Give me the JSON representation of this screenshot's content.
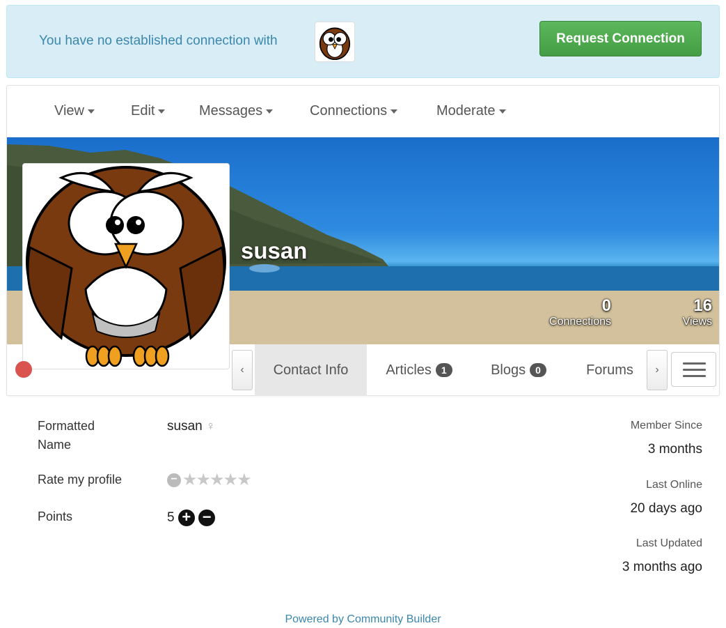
{
  "alert": {
    "text": "You have no established connection with",
    "button_label": "Request Connection"
  },
  "menu": {
    "items": [
      {
        "label": "View"
      },
      {
        "label": "Edit"
      },
      {
        "label": "Messages"
      },
      {
        "label": "Connections"
      },
      {
        "label": "Moderate"
      }
    ]
  },
  "profile": {
    "name": "susan",
    "status_color": "#d9534f",
    "stats": {
      "connections": {
        "value": "0",
        "label": "Connections"
      },
      "views": {
        "value": "16",
        "label": "Views"
      }
    }
  },
  "tabs": {
    "prev_icon": "chevron-left-icon",
    "next_icon": "chevron-right-icon",
    "items": [
      {
        "label": "Contact Info",
        "active": true
      },
      {
        "label": "Articles",
        "badge": "1"
      },
      {
        "label": "Blogs",
        "badge": "0"
      },
      {
        "label": "Forums"
      }
    ]
  },
  "fields": {
    "formatted_name_label": "Formatted Name",
    "formatted_name_value": "susan",
    "gender_icon": "female-icon",
    "rating_label": "Rate my profile",
    "rating_value": 0,
    "rating_max": 5,
    "points_label": "Points",
    "points_value": "5",
    "member_since_label": "Member Since",
    "member_since_value": "3 months",
    "last_online_label": "Last Online",
    "last_online_value": "20 days ago",
    "last_updated_label": "Last Updated",
    "last_updated_value": "3 months ago"
  },
  "footer": {
    "text": "Powered by Community Builder"
  },
  "colors": {
    "alert_bg": "#d9edf7",
    "alert_text": "#3a87ad",
    "button": "#5cb85c",
    "badge": "#555555"
  }
}
